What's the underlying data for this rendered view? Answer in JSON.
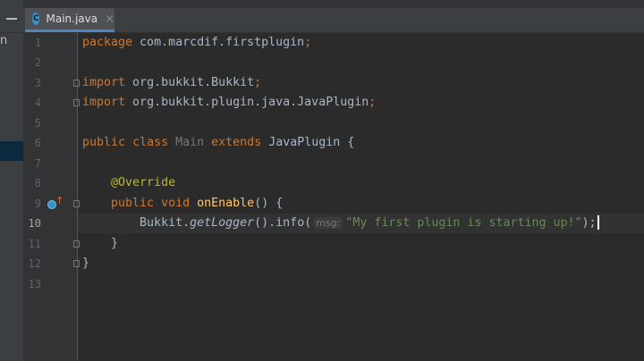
{
  "tab": {
    "label": "Main.java",
    "icon": "C",
    "close": "×"
  },
  "left_strip": {
    "truncated_text": "n"
  },
  "line_numbers": [
    "1",
    "2",
    "3",
    "4",
    "5",
    "6",
    "7",
    "8",
    "9",
    "10",
    "11",
    "12",
    "13"
  ],
  "current_line": 10,
  "code": {
    "l1": {
      "kw": "package",
      "rest": " com.marcdif.firstplugin",
      "semi": ";"
    },
    "l3": {
      "kw": "import",
      "rest": " org.bukkit.Bukkit",
      "semi": ";"
    },
    "l4": {
      "kw": "import",
      "rest": " org.bukkit.plugin.java.JavaPlugin",
      "semi": ";"
    },
    "l6": {
      "kw1": "public",
      "kw2": "class",
      "cls": "Main",
      "kw3": "extends",
      "rest": " JavaPlugin {"
    },
    "l8": {
      "ann": "@Override"
    },
    "l9": {
      "kw1": "public",
      "kw2": "void",
      "fn": "onEnable",
      "rest": "() {"
    },
    "l10": {
      "a": "Bukkit.",
      "it": "getLogger",
      "b": "().info(",
      "hint": "msg:",
      "str": "\"My first plugin is starting up!\"",
      "c": ");"
    },
    "l11": {
      "brace": "}"
    },
    "l12": {
      "brace": "}"
    }
  },
  "colors": {
    "keyword": "#cc7832",
    "annotation": "#bbb529",
    "string": "#6a8759",
    "method": "#ffc66d",
    "text": "#a9b7c6"
  }
}
